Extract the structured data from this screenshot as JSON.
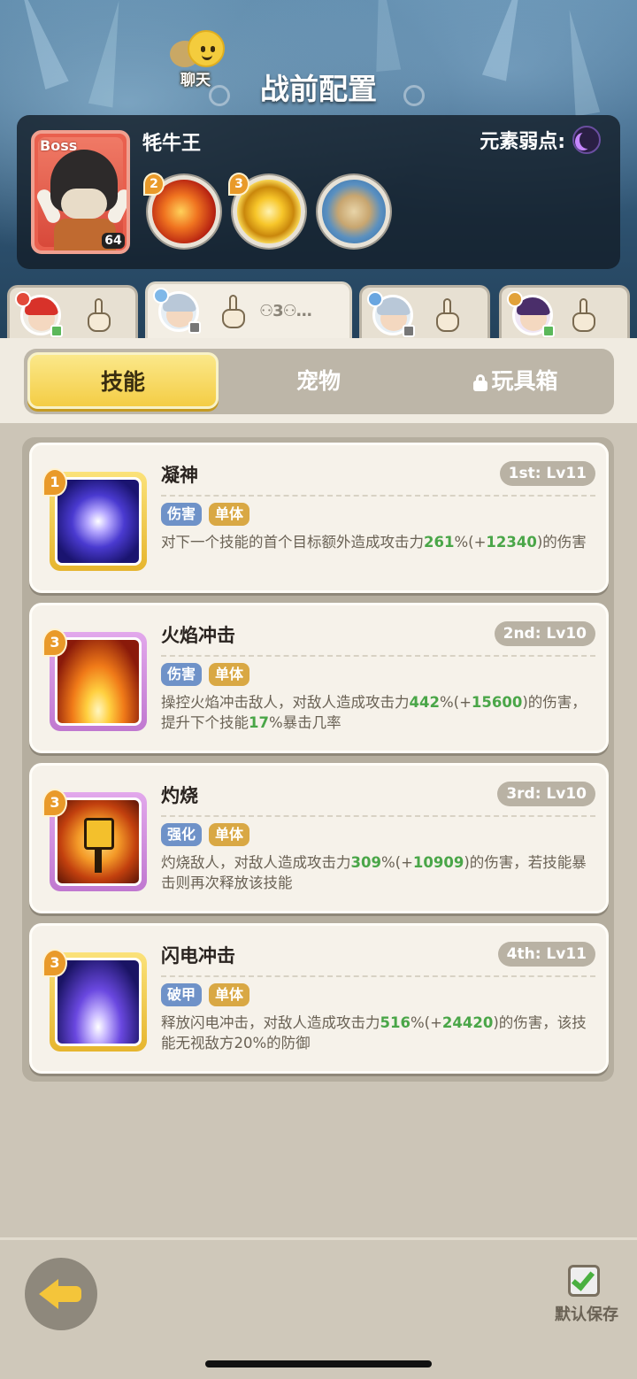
{
  "header": {
    "chat_label": "聊天",
    "title": "战前配置"
  },
  "boss": {
    "tag": "Boss",
    "name": "牦牛王",
    "level": "64",
    "weakness_label": "元素弱点:",
    "weakness_icon": "moon-icon",
    "skills": [
      {
        "icon": "fire-claw-icon",
        "count": "2"
      },
      {
        "icon": "golden-ring-icon",
        "count": "3"
      },
      {
        "icon": "rock-armor-icon",
        "count": ""
      }
    ]
  },
  "team_tabs": [
    {
      "avatar": "red-hair-hero-avatar",
      "element": "fire"
    },
    {
      "avatar": "silver-hair-hero-avatar",
      "element": "ice",
      "extra": "⚇3⚇…"
    },
    {
      "avatar": "silver-hair-hero-avatar",
      "element": "lightning"
    },
    {
      "avatar": "dark-hair-hero-avatar",
      "element": "lightning"
    }
  ],
  "category_tabs": {
    "skills": "技能",
    "pets": "宠物",
    "toybox": "玩具箱"
  },
  "skills": [
    {
      "rank": "1",
      "name": "凝神",
      "order": "1st: Lv11",
      "tags": [
        "伤害",
        "单体"
      ],
      "desc_parts": [
        "对下一个技能的首个目标额外造成攻击力",
        "261",
        "%(+",
        "12340",
        ")的伤害"
      ],
      "icon": "focus-eye-icon"
    },
    {
      "rank": "3",
      "name": "火焰冲击",
      "order": "2nd: Lv10",
      "tags": [
        "伤害",
        "单体"
      ],
      "desc_parts": [
        "操控火焰冲击敌人，对敌人造成攻击力",
        "442",
        "%(+",
        "15600",
        ")的伤害，提升下个技能",
        "17",
        "%暴击几率"
      ],
      "icon": "flame-burst-icon"
    },
    {
      "rank": "3",
      "name": "灼烧",
      "order": "3rd: Lv10",
      "tags": [
        "强化",
        "单体"
      ],
      "desc_parts": [
        "灼烧敌人，对敌人造成攻击力",
        "309",
        "%(+",
        "10909",
        ")的伤害，若技能暴击则再次释放该技能"
      ],
      "icon": "burning-figure-icon"
    },
    {
      "rank": "3",
      "name": "闪电冲击",
      "order": "4th: Lv11",
      "tags": [
        "破甲",
        "单体"
      ],
      "desc_parts": [
        "释放闪电冲击，对敌人造成攻击力",
        "516",
        "%(+",
        "24420",
        ")的伤害，该技能无视敌方20%的防御"
      ],
      "icon": "lightning-strike-icon"
    }
  ],
  "bottom": {
    "save_label": "默认保存"
  }
}
